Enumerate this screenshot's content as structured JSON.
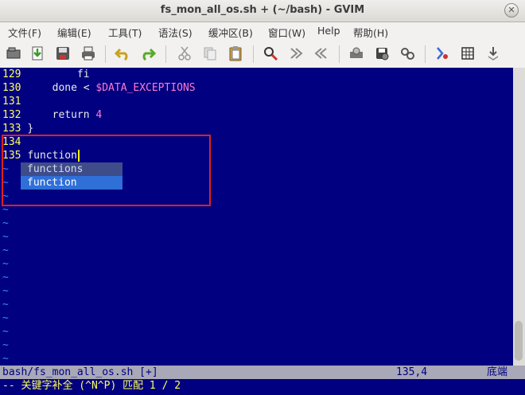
{
  "window": {
    "title": "fs_mon_all_os.sh + (~/bash) - GVIM"
  },
  "menu": [
    "文件(F)",
    "编辑(E)",
    "工具(T)",
    "语法(S)",
    "缓冲区(B)",
    "窗口(W)",
    "Help",
    "帮助(H)"
  ],
  "toolbar": [
    "open-icon",
    "save-icon",
    "save-all-icon",
    "print-icon",
    "undo-icon",
    "redo-icon",
    "cut-icon",
    "copy-icon",
    "paste-icon",
    "find-replace-icon",
    "forward-icon",
    "back-icon",
    "session-icon",
    "make-icon",
    "run-script-icon",
    "tags-icon",
    "build-icon",
    "jump-icon"
  ],
  "code": [
    {
      "num": "129",
      "text": "        fi"
    },
    {
      "num": "130",
      "text": "    done < ",
      "str": "$DATA_EXCEPTIONS"
    },
    {
      "num": "131",
      "text": ""
    },
    {
      "num": "132",
      "text": "    return ",
      "str": "4"
    },
    {
      "num": "133",
      "text": "}"
    },
    {
      "num": "134",
      "text": ""
    },
    {
      "num": "135",
      "text": "function"
    }
  ],
  "completion": [
    "functions",
    "function"
  ],
  "statusline": {
    "file": "bash/fs_mon_all_os.sh [+]",
    "position": "135,4",
    "scroll": "底端"
  },
  "cmdline": "-- 关键字补全 (^N^P) 匹配 1 / 2"
}
